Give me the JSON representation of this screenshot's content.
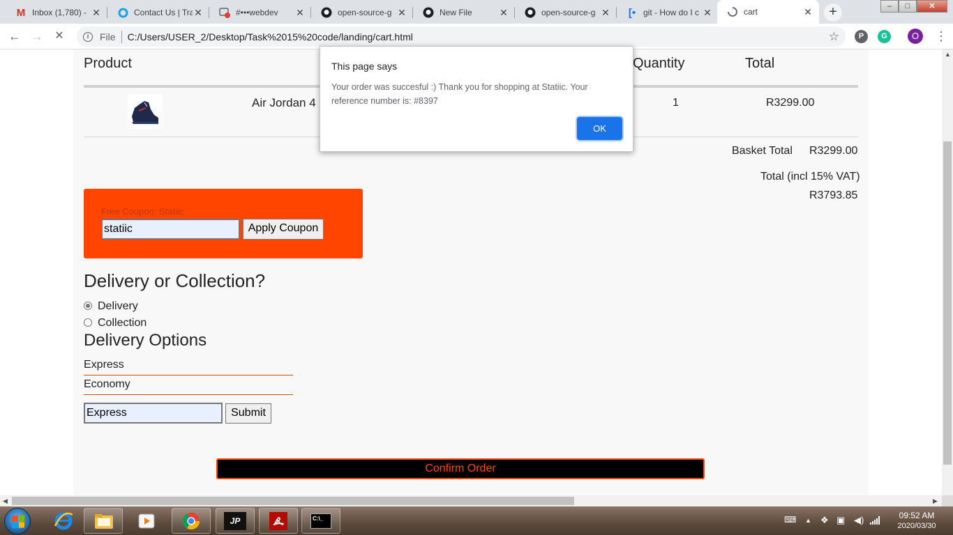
{
  "browser": {
    "tabs": [
      {
        "label": "Inbox (1,780) -",
        "icon": "gmail-icon"
      },
      {
        "label": "Contact Us | Tra",
        "icon": "circle-icon"
      },
      {
        "label": "#•••webdev",
        "icon": "screencast-icon"
      },
      {
        "label": "open-source-g",
        "icon": "github-icon"
      },
      {
        "label": "New File",
        "icon": "github-icon"
      },
      {
        "label": "open-source-g",
        "icon": "github-icon"
      },
      {
        "label": "git - How do I c",
        "icon": "bracket-icon"
      },
      {
        "label": "cart",
        "icon": "loading-spinner-icon"
      }
    ],
    "new_tab_symbol": "+",
    "address": {
      "scheme": "File",
      "url": "C:/Users/USER_2/Desktop/Task%2015%20code/landing/cart.html"
    },
    "profile_initial": "O"
  },
  "cart": {
    "headers": {
      "product": "Product",
      "quantity": "Quantity",
      "total": "Total"
    },
    "item": {
      "name": "Air Jordan 4",
      "quantity": "1",
      "total": "R3299.00"
    },
    "basket_total_label": "Basket Total",
    "basket_total_value": "R3299.00",
    "vat_label": "Total (incl 15% VAT)",
    "vat_value": "R3793.85"
  },
  "coupon": {
    "hint": "Free Coupon: Statiic",
    "value": "statiic",
    "button": "Apply Coupon"
  },
  "delivery": {
    "heading": "Delivery or Collection?",
    "options": [
      {
        "label": "Delivery",
        "checked": true
      },
      {
        "label": "Collection",
        "checked": false
      }
    ],
    "options_heading": "Delivery Options",
    "option_list": [
      "Express",
      "Economy"
    ],
    "selected_value": "Express",
    "submit": "Submit"
  },
  "confirm_button": "Confirm Order",
  "dialog": {
    "title": "This page says",
    "message": "Your order was succesful :) Thank you for shopping at Statiic. Your reference number is: #8397",
    "ok": "OK"
  },
  "taskbar": {
    "time": "09:52 AM",
    "date": "2020/03/30",
    "apps": [
      "start-button",
      "internet-explorer",
      "file-explorer",
      "media-player",
      "chrome",
      "jp-markets",
      "adobe-reader",
      "command-prompt"
    ]
  },
  "colors": {
    "accent_orange": "#ff4500",
    "dialog_ok_blue": "#1a73e8",
    "autofill_blue": "#e8f0fe"
  }
}
